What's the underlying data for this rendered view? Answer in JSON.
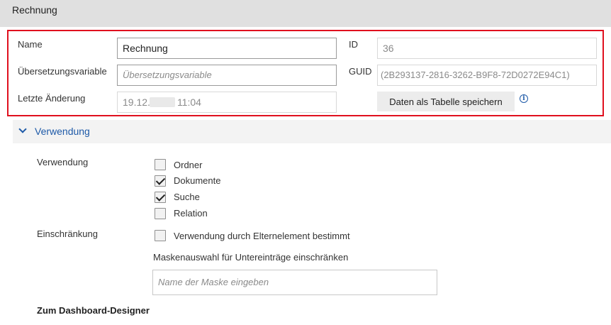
{
  "header": {
    "title": "Rechnung"
  },
  "form": {
    "name_label": "Name",
    "name_value": "Rechnung",
    "translation_label": "Übersetzungsvariable",
    "translation_placeholder": "Übersetzungsvariable",
    "last_change_label": "Letzte Änderung",
    "last_change_date_prefix": "19.12.",
    "last_change_time": "11:04",
    "id_label": "ID",
    "id_value": "36",
    "guid_label": "GUID",
    "guid_value": "(2B293137-2816-3262-B9F8-72D0272E94C1)",
    "save_table_button": "Daten als Tabelle speichern",
    "info_icon_glyph": "i"
  },
  "usage_section": {
    "title": "Verwendung",
    "usage_label": "Verwendung",
    "options": [
      {
        "label": "Ordner",
        "checked": false
      },
      {
        "label": "Dokumente",
        "checked": true
      },
      {
        "label": "Suche",
        "checked": true
      },
      {
        "label": "Relation",
        "checked": false
      }
    ],
    "restriction_label": "Einschränkung",
    "parent_option": {
      "label": "Verwendung durch Elternelement bestimmt",
      "checked": false
    },
    "mask_restriction_label": "Maskenauswahl für Untereinträge einschränken",
    "mask_input_placeholder": "Name der Maske eingeben"
  },
  "dashboard_link": "Zum Dashboard-Designer",
  "colors": {
    "highlight_border": "#e0101e",
    "accent": "#1e5aa8",
    "header_bg": "#e0e0e0"
  }
}
